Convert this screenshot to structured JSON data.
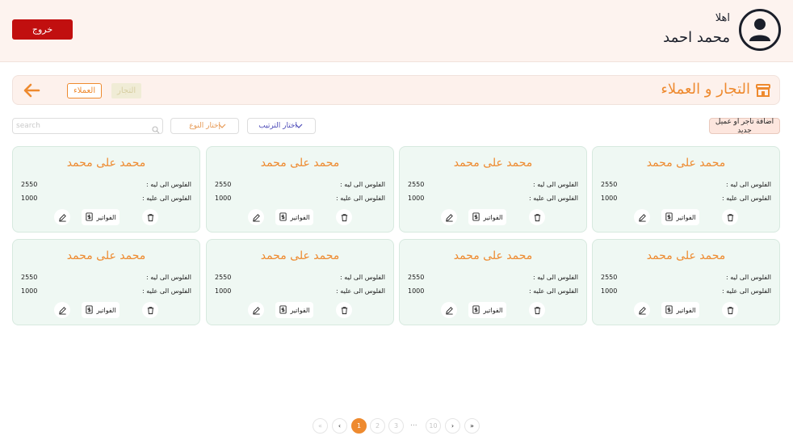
{
  "header": {
    "greeting": "اهلا",
    "user_name": "محمد احمد",
    "logout_label": "خروج"
  },
  "titlebar": {
    "title": "التجار و العملاء",
    "tab_clients": "العملاء",
    "tab_merchants": "التجار"
  },
  "toolbar": {
    "add_label": "اضافة تاجر او عميل جديد",
    "sort_label": "اختار الترتيب",
    "type_label": "إختار النوع",
    "search_placeholder": "search"
  },
  "cards": [
    {
      "name": "محمد على محمد",
      "owed_label": "الفلوس الى ليه :",
      "owed_value": "2550",
      "owing_label": "الفلوس الى عليه :",
      "owing_value": "1000",
      "invoices_label": "الفواتير"
    },
    {
      "name": "محمد على محمد",
      "owed_label": "الفلوس الى ليه :",
      "owed_value": "2550",
      "owing_label": "الفلوس الى عليه :",
      "owing_value": "1000",
      "invoices_label": "الفواتير"
    },
    {
      "name": "محمد على محمد",
      "owed_label": "الفلوس الى ليه :",
      "owed_value": "2550",
      "owing_label": "الفلوس الى عليه :",
      "owing_value": "1000",
      "invoices_label": "الفواتير"
    },
    {
      "name": "محمد على محمد",
      "owed_label": "الفلوس الى ليه :",
      "owed_value": "2550",
      "owing_label": "الفلوس الى عليه :",
      "owing_value": "1000",
      "invoices_label": "الفواتير"
    },
    {
      "name": "محمد على محمد",
      "owed_label": "الفلوس الى ليه :",
      "owed_value": "2550",
      "owing_label": "الفلوس الى عليه :",
      "owing_value": "1000",
      "invoices_label": "الفواتير"
    },
    {
      "name": "محمد على محمد",
      "owed_label": "الفلوس الى ليه :",
      "owed_value": "2550",
      "owing_label": "الفلوس الى عليه :",
      "owing_value": "1000",
      "invoices_label": "الفواتير"
    },
    {
      "name": "محمد على محمد",
      "owed_label": "الفلوس الى ليه :",
      "owed_value": "2550",
      "owing_label": "الفلوس الى عليه :",
      "owing_value": "1000",
      "invoices_label": "الفواتير"
    },
    {
      "name": "محمد على محمد",
      "owed_label": "الفلوس الى ليه :",
      "owed_value": "2550",
      "owing_label": "الفلوس الى عليه :",
      "owing_value": "1000",
      "invoices_label": "الفواتير"
    }
  ],
  "pagination": {
    "first": "«",
    "prev": "‹",
    "pages": [
      "1",
      "2",
      "3"
    ],
    "ellipsis": "...",
    "last_page": "10",
    "next": "›",
    "last": "»",
    "current": "1"
  },
  "colors": {
    "accent": "#ee8a2f",
    "danger": "#c10f0f",
    "card_bg": "#eff8f3",
    "header_bg": "#fdf3ef"
  }
}
